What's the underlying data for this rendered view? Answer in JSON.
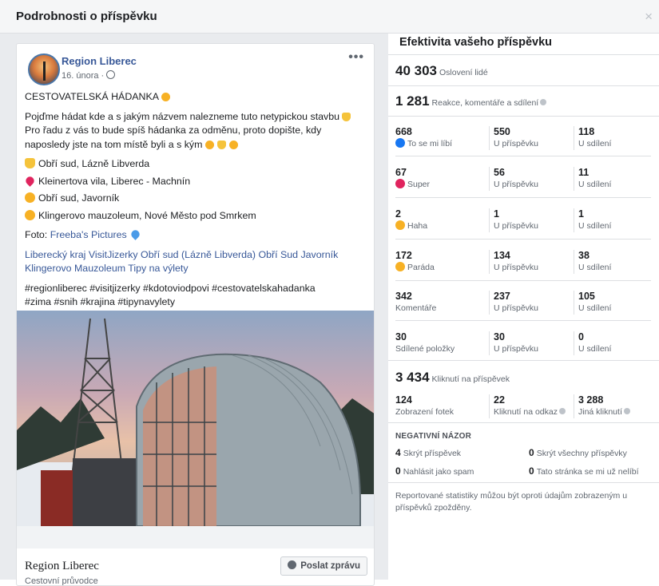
{
  "modal": {
    "title": "Podrobnosti o příspěvku",
    "close": "×"
  },
  "post": {
    "page_name": "Region Liberec",
    "date": "16. února ·",
    "more": "•••",
    "headline": "CESTOVATELSKÁ HÁDANKA",
    "intro": "Pojďme hádat kde a s jakým názvem nalezneme tuto netypickou stavbu",
    "intro2": "Pro řadu z vás to bude spíš hádanka za odměnu, proto dopište, kdy naposledy jste na tom místě byli a s kým",
    "answers": [
      {
        "icon": "thumb-emoji",
        "text": "Obří sud, Lázně Libverda"
      },
      {
        "icon": "heart-emoji",
        "text": "Kleinertova vila, Liberec - Machnín"
      },
      {
        "icon": "wow-emoji",
        "text": "Obří sud, Javorník"
      },
      {
        "icon": "laugh-emoji",
        "text": "Klingerovo mauzoleum, Nové Město pod Smrkem"
      }
    ],
    "photo_label": "Foto:",
    "photo_credit": "Freeba's Pictures",
    "tags_line1": "Liberecký kraj VisitJizerky Obří sud (Lázně Libverda) Obří Sud Javorník",
    "tags_line2": "Klingerovo Mauzoleum Tipy na výlety",
    "hashtags_line1": "#regionliberec #visitjizerky #kdotoviodpovi #cestovatelskahadanka",
    "hashtags_line2": "#zima #snih #krajina #tipynavylety",
    "footer_name": "Region Liberec",
    "footer_category": "Cestovní průvodce",
    "message_button": "Poslat zprávu"
  },
  "stats": {
    "title": "Efektivita vašeho příspěvku",
    "reach_value": "40 303",
    "reach_label": "Oslovení lidé",
    "engagement_value": "1 281",
    "engagement_label": "Reakce, komentáře a sdílení",
    "rows": [
      {
        "total": "668",
        "label": "To se mi líbí",
        "icon": "like",
        "on_post": "550",
        "on_post_label": "U příspěvku",
        "on_shares": "118",
        "on_shares_label": "U sdílení"
      },
      {
        "total": "67",
        "label": "Super",
        "icon": "love",
        "on_post": "56",
        "on_post_label": "U příspěvku",
        "on_shares": "11",
        "on_shares_label": "U sdílení"
      },
      {
        "total": "2",
        "label": "Haha",
        "icon": "haha",
        "on_post": "1",
        "on_post_label": "U příspěvku",
        "on_shares": "1",
        "on_shares_label": "U sdílení"
      },
      {
        "total": "172",
        "label": "Paráda",
        "icon": "wow",
        "on_post": "134",
        "on_post_label": "U příspěvku",
        "on_shares": "38",
        "on_shares_label": "U sdílení"
      },
      {
        "total": "342",
        "label": "Komentáře",
        "icon": "",
        "on_post": "237",
        "on_post_label": "U příspěvku",
        "on_shares": "105",
        "on_shares_label": "U sdílení"
      },
      {
        "total": "30",
        "label": "Sdílené položky",
        "icon": "",
        "on_post": "30",
        "on_post_label": "U příspěvku",
        "on_shares": "0",
        "on_shares_label": "U sdílení"
      }
    ],
    "clicks_value": "3 434",
    "clicks_label": "Kliknutí na příspěvek",
    "clicks": [
      {
        "value": "124",
        "label": "Zobrazení fotek"
      },
      {
        "value": "22",
        "label": "Kliknutí na odkaz"
      },
      {
        "value": "3 288",
        "label": "Jiná kliknutí"
      }
    ],
    "negative_title": "NEGATIVNÍ NÁZOR",
    "negative": [
      {
        "value": "4",
        "label": "Skrýt příspěvek"
      },
      {
        "value": "0",
        "label": "Skrýt všechny příspěvky"
      },
      {
        "value": "0",
        "label": "Nahlásit jako spam"
      },
      {
        "value": "0",
        "label": "Tato stránka se mi už nelíbí"
      }
    ],
    "note": "Reportované statistiky můžou být oproti údajům zobrazeným u příspěvků zpožděny."
  },
  "colors": {
    "link": "#385898",
    "like": "#1877f2",
    "love": "#e0245e",
    "yellow": "#f7b125"
  }
}
